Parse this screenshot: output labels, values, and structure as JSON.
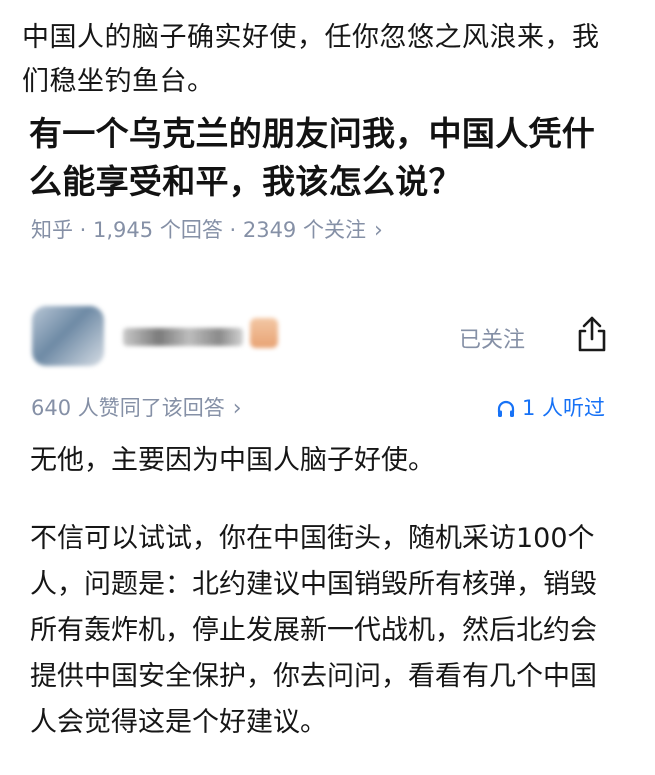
{
  "post": {
    "caption": "中国人的脑子确实好使，任你忽悠之风浪来，我们稳坐钓鱼台。"
  },
  "question": {
    "title": "有一个乌克兰的朋友问我，中国人凭什么能享受和平，我该怎么说？",
    "meta": "知乎 · 1,945 个回答 · 2349 个关注",
    "meta_chevron": "›"
  },
  "answer": {
    "follow_status": "已关注",
    "likes_text": "640 人赞同了该回答",
    "likes_chevron": "›",
    "listen_text": "1 人听过",
    "paragraphs": [
      "无他，主要因为中国人脑子好使。",
      "不信可以试试，你在中国街头，随机采访100个人，问题是：北约建议中国销毁所有核弹，销毁所有轰炸机，停止发展新一代战机，然后北约会提供中国安全保护，你去问问，看看有几个中国人会觉得这是个好建议。"
    ]
  },
  "icons": {
    "share": "share-icon",
    "headphones": "headphones-icon",
    "chevron": "chevron-right-icon"
  },
  "colors": {
    "meta_gray": "#8590a6",
    "link_blue": "#1772f6",
    "text": "#161616"
  }
}
